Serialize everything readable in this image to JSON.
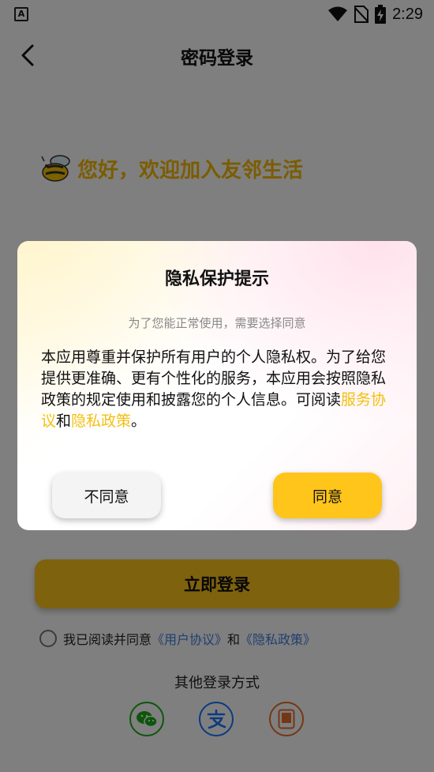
{
  "status_bar": {
    "app_glyph": "A",
    "time": "2:29"
  },
  "nav": {
    "title": "密码登录"
  },
  "greeting": {
    "text": "您好，欢迎加入友邻生活"
  },
  "login": {
    "button_label": "立即登录"
  },
  "agreement": {
    "prefix": "我已阅读并同意",
    "user_agreement": "《用户协议》",
    "and": "和",
    "privacy_policy": "《隐私政策》"
  },
  "other_login": {
    "title": "其他登录方式"
  },
  "dialog": {
    "title": "隐私保护提示",
    "subtitle": "为了您能正常使用，需要选择同意",
    "body_text": "本应用尊重并保护所有用户的个人隐私权。为了给您提供更准确、更有个性化的服务，本应用会按照隐私政策的规定使用和披露您的个人信息。可阅读",
    "link_service": "服务协议",
    "and": "和",
    "link_privacy": "隐私政策",
    "period": "。",
    "disagree_label": "不同意",
    "agree_label": "同意"
  },
  "colors": {
    "accent": "#ffc51a",
    "link_yellow": "#f4bf10",
    "link_blue": "#3f7fe0"
  }
}
